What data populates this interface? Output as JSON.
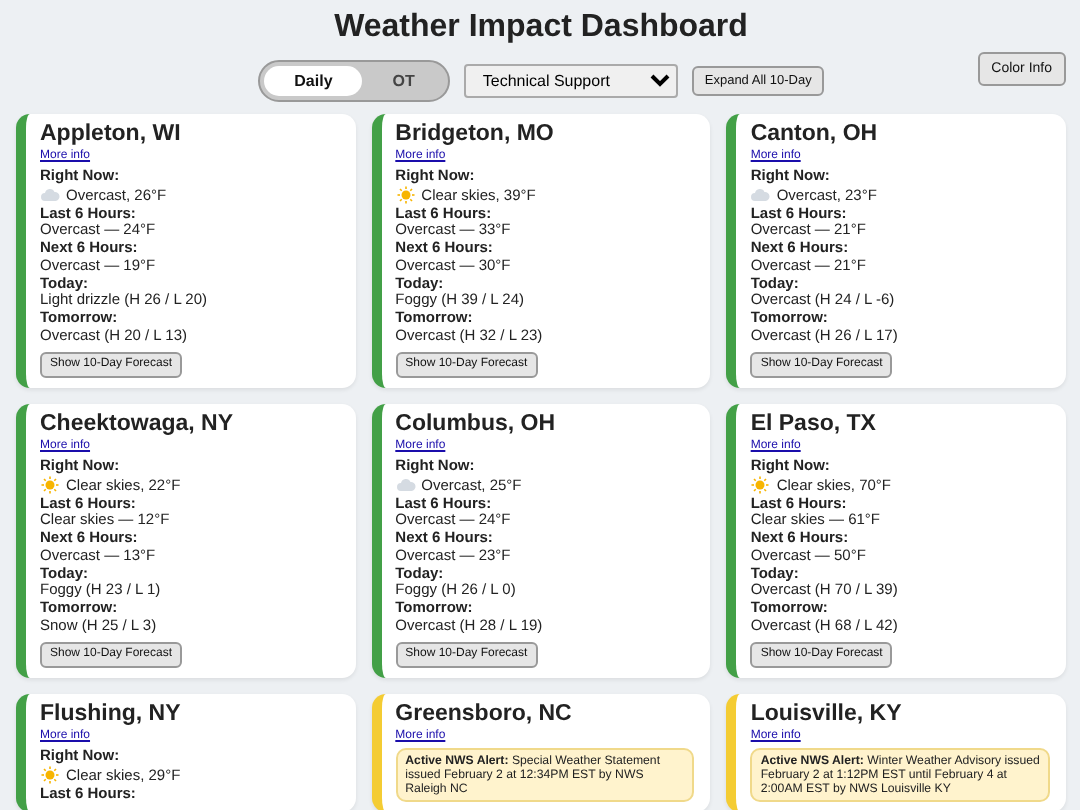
{
  "title": "Weather Impact Dashboard",
  "toggle": [
    {
      "label": "Daily",
      "selected": true
    },
    {
      "label": "OT",
      "selected": false
    }
  ],
  "team_select": {
    "value": "Technical Support"
  },
  "expand_button": "Expand All 10-Day",
  "color_info_button": "Color Info",
  "cards": [
    {
      "kind": "weather",
      "city": "Appleton, WI",
      "color": "#43a047",
      "link": "More info",
      "right_now_label": "Right Now:",
      "right_now": {
        "kind": "cloud",
        "text": "Overcast, 26°F"
      },
      "sections": [
        {
          "label": "Last 6 Hours:",
          "value": "Overcast — 24°F"
        },
        {
          "label": "Next 6 Hours:",
          "value": "Overcast — 19°F"
        },
        {
          "label": "Today:",
          "value": "Light drizzle (H 26 / L 20)"
        },
        {
          "label": "Tomorrow:",
          "value": "Overcast (H 20 / L 13)"
        }
      ],
      "button": "Show 10-Day Forecast"
    },
    {
      "kind": "weather",
      "city": "Bridgeton, MO",
      "color": "#43a047",
      "link": "More info",
      "right_now_label": "Right Now:",
      "right_now": {
        "kind": "sun",
        "text": "Clear skies, 39°F"
      },
      "sections": [
        {
          "label": "Last 6 Hours:",
          "value": "Overcast — 33°F"
        },
        {
          "label": "Next 6 Hours:",
          "value": "Overcast — 30°F"
        },
        {
          "label": "Today:",
          "value": "Foggy (H 39 / L 24)"
        },
        {
          "label": "Tomorrow:",
          "value": "Overcast (H 32 / L 23)"
        }
      ],
      "button": "Show 10-Day Forecast"
    },
    {
      "kind": "weather",
      "city": "Canton, OH",
      "color": "#43a047",
      "link": "More info",
      "right_now_label": "Right Now:",
      "right_now": {
        "kind": "cloud",
        "text": "Overcast, 23°F"
      },
      "sections": [
        {
          "label": "Last 6 Hours:",
          "value": "Overcast — 21°F"
        },
        {
          "label": "Next 6 Hours:",
          "value": "Overcast — 21°F"
        },
        {
          "label": "Today:",
          "value": "Overcast (H 24 / L -6)"
        },
        {
          "label": "Tomorrow:",
          "value": "Overcast (H 26 / L 17)"
        }
      ],
      "button": "Show 10-Day Forecast"
    },
    {
      "kind": "weather",
      "city": "Cheektowaga, NY",
      "color": "#43a047",
      "link": "More info",
      "right_now_label": "Right Now:",
      "right_now": {
        "kind": "sun",
        "text": "Clear skies, 22°F"
      },
      "sections": [
        {
          "label": "Last 6 Hours:",
          "value": "Clear skies — 12°F"
        },
        {
          "label": "Next 6 Hours:",
          "value": "Overcast — 13°F"
        },
        {
          "label": "Today:",
          "value": "Foggy (H 23 / L 1)"
        },
        {
          "label": "Tomorrow:",
          "value": "Snow (H 25 / L 3)"
        }
      ],
      "button": "Show 10-Day Forecast"
    },
    {
      "kind": "weather",
      "city": "Columbus, OH",
      "color": "#43a047",
      "link": "More info",
      "right_now_label": "Right Now:",
      "right_now": {
        "kind": "cloud",
        "text": "Overcast, 25°F"
      },
      "sections": [
        {
          "label": "Last 6 Hours:",
          "value": "Overcast — 24°F"
        },
        {
          "label": "Next 6 Hours:",
          "value": "Overcast — 23°F"
        },
        {
          "label": "Today:",
          "value": "Foggy (H 26 / L 0)"
        },
        {
          "label": "Tomorrow:",
          "value": "Overcast (H 28 / L 19)"
        }
      ],
      "button": "Show 10-Day Forecast"
    },
    {
      "kind": "weather",
      "city": "El Paso, TX",
      "color": "#43a047",
      "link": "More info",
      "right_now_label": "Right Now:",
      "right_now": {
        "kind": "sun",
        "text": "Clear skies, 70°F"
      },
      "sections": [
        {
          "label": "Last 6 Hours:",
          "value": "Clear skies — 61°F"
        },
        {
          "label": "Next 6 Hours:",
          "value": "Overcast — 50°F"
        },
        {
          "label": "Today:",
          "value": "Overcast (H 70 / L 39)"
        },
        {
          "label": "Tomorrow:",
          "value": "Overcast (H 68 / L 42)"
        }
      ],
      "button": "Show 10-Day Forecast"
    },
    {
      "kind": "weather",
      "city": "Flushing, NY",
      "color": "#43a047",
      "link": "More info",
      "right_now_label": "Right Now:",
      "right_now": {
        "kind": "sun",
        "text": "Clear skies, 29°F"
      },
      "sections": [
        {
          "label": "Last 6 Hours:"
        }
      ]
    },
    {
      "kind": "alert",
      "city": "Greensboro, NC",
      "color": "#f4cc33",
      "link": "More info",
      "alert": "**Active NWS Alert:** Special Weather Statement issued February 2 at 12:34PM EST by NWS Raleigh NC"
    },
    {
      "kind": "alert",
      "city": "Louisville, KY",
      "color": "#f4cc33",
      "link": "More info",
      "alert": "**Active NWS Alert:** Winter Weather Advisory issued February 2 at 1:12PM EST until February 4 at 2:00AM EST by NWS Louisville KY"
    }
  ]
}
